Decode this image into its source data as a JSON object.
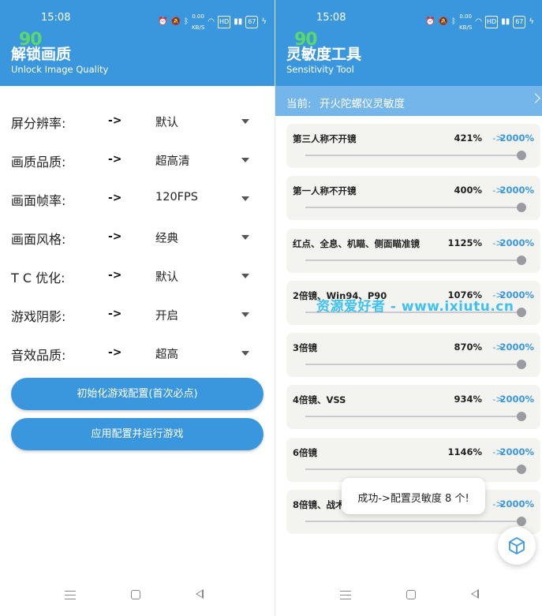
{
  "status_bar": {
    "time": "15:08",
    "speed": "0.00\nKB/S",
    "hd": "HD",
    "battery": "67"
  },
  "left_screen": {
    "fps_badge": "90",
    "title": "解锁画质",
    "subtitle": "Unlock Image Quality",
    "arrow": "->",
    "settings": [
      {
        "label": "屏分辨率:",
        "value": "默认"
      },
      {
        "label": "画质品质:",
        "value": "超高清"
      },
      {
        "label": "画面帧率:",
        "value": "120FPS"
      },
      {
        "label": "画面风格:",
        "value": "经典"
      },
      {
        "label": "T C 优化:",
        "value": "默认"
      },
      {
        "label": "游戏阴影:",
        "value": "开启"
      },
      {
        "label": "音效品质:",
        "value": "超高"
      }
    ],
    "buttons": {
      "init": "初始化游戏配置(首次必点)",
      "apply": "应用配置并运行游戏"
    }
  },
  "right_screen": {
    "fps_badge": "90",
    "title": "灵敏度工具",
    "subtitle": "Sensitivity Tool",
    "current_prefix": "当前:",
    "current_value": "开火陀螺仪灵敏度",
    "arrow": "->",
    "items": [
      {
        "label": "第三人称不开镜",
        "current": "421%",
        "target": "2000%",
        "slider": 1.0
      },
      {
        "label": "第一人称不开镜",
        "current": "400%",
        "target": "2000%",
        "slider": 1.0
      },
      {
        "label": "红点、全息、机瞄、侧面瞄准镜",
        "current": "1125%",
        "target": "2000%",
        "slider": 1.0
      },
      {
        "label": "2倍镜、Win94、P90",
        "current": "1076%",
        "target": "2000%",
        "slider": 1.0
      },
      {
        "label": "3倍镜",
        "current": "870%",
        "target": "2000%",
        "slider": 1.0
      },
      {
        "label": "4倍镜、VSS",
        "current": "934%",
        "target": "2000%",
        "slider": 1.0
      },
      {
        "label": "6倍镜",
        "current": "1146%",
        "target": "2000%",
        "slider": 1.0
      },
      {
        "label": "8倍镜、战术",
        "current": "",
        "target": "2000%",
        "slider": 1.0
      }
    ],
    "toast": "成功->配置灵敏度 8 个!",
    "watermark": "资源爱好者 - www.ixiutu.cn",
    "fab_icon": "cube-icon"
  },
  "colors": {
    "primary": "#3a97dd",
    "current_bar": "#74b5ea",
    "card_bg": "#f3f3f0",
    "fps_badge": "#5fe05f",
    "watermark": "#36bff0"
  }
}
